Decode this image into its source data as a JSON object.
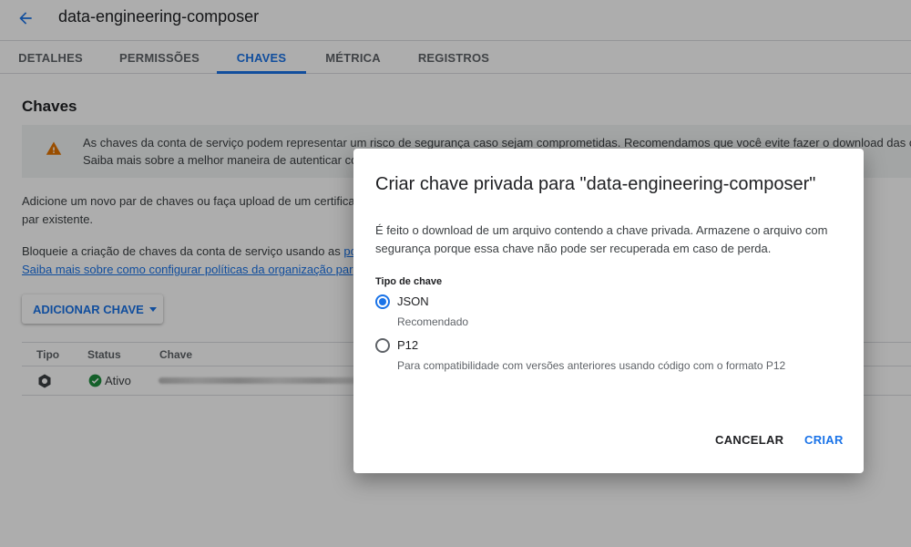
{
  "header": {
    "title": "data-engineering-composer",
    "back_icon": "arrow-left-icon"
  },
  "tabs": [
    {
      "label": "DETALHES"
    },
    {
      "label": "PERMISSÕES"
    },
    {
      "label": "CHAVES",
      "active": true
    },
    {
      "label": "MÉTRICA"
    },
    {
      "label": "REGISTROS"
    }
  ],
  "content": {
    "section_title": "Chaves",
    "warning": {
      "icon": "warning-icon",
      "line1": "As chaves da conta de serviço podem representar um risco de segurança caso sejam comprometidas. Recomendamos que você evite fazer o download das c",
      "line2": "Saiba mais sobre a melhor maneira de autenticar co"
    },
    "add_text_line1": "Adicione um novo par de chaves ou faça upload de um certifica",
    "add_text_line2": "par existente.",
    "block_text": "Bloqueie a criação de chaves da conta de serviço usando as ",
    "block_link": "po",
    "learn_link": "Saiba mais sobre como configurar políticas da organização par",
    "add_key_button": "ADICIONAR CHAVE",
    "table": {
      "headers": [
        "Tipo",
        "Status",
        "Chave"
      ],
      "rows": [
        {
          "type_icon": "key-type-icon",
          "status_icon": "check-circle-icon",
          "status": "Ativo"
        }
      ]
    }
  },
  "dialog": {
    "title": "Criar chave privada para \"data-engineering-composer\"",
    "description": "É feito o download de um arquivo contendo a chave privada. Armazene o arquivo com segurança porque essa chave não pode ser recuperada em caso de perda.",
    "key_type_label": "Tipo de chave",
    "options": [
      {
        "label": "JSON",
        "help": "Recomendado",
        "selected": true
      },
      {
        "label": "P12",
        "help": "Para compatibilidade com versões anteriores usando código com o formato P12",
        "selected": false
      }
    ],
    "cancel_label": "CANCELAR",
    "create_label": "CRIAR"
  },
  "colors": {
    "accent": "#1a73e8",
    "warning": "#e37400",
    "success": "#1e8e3e",
    "scrim": "rgba(0,0,0,0.32)"
  }
}
